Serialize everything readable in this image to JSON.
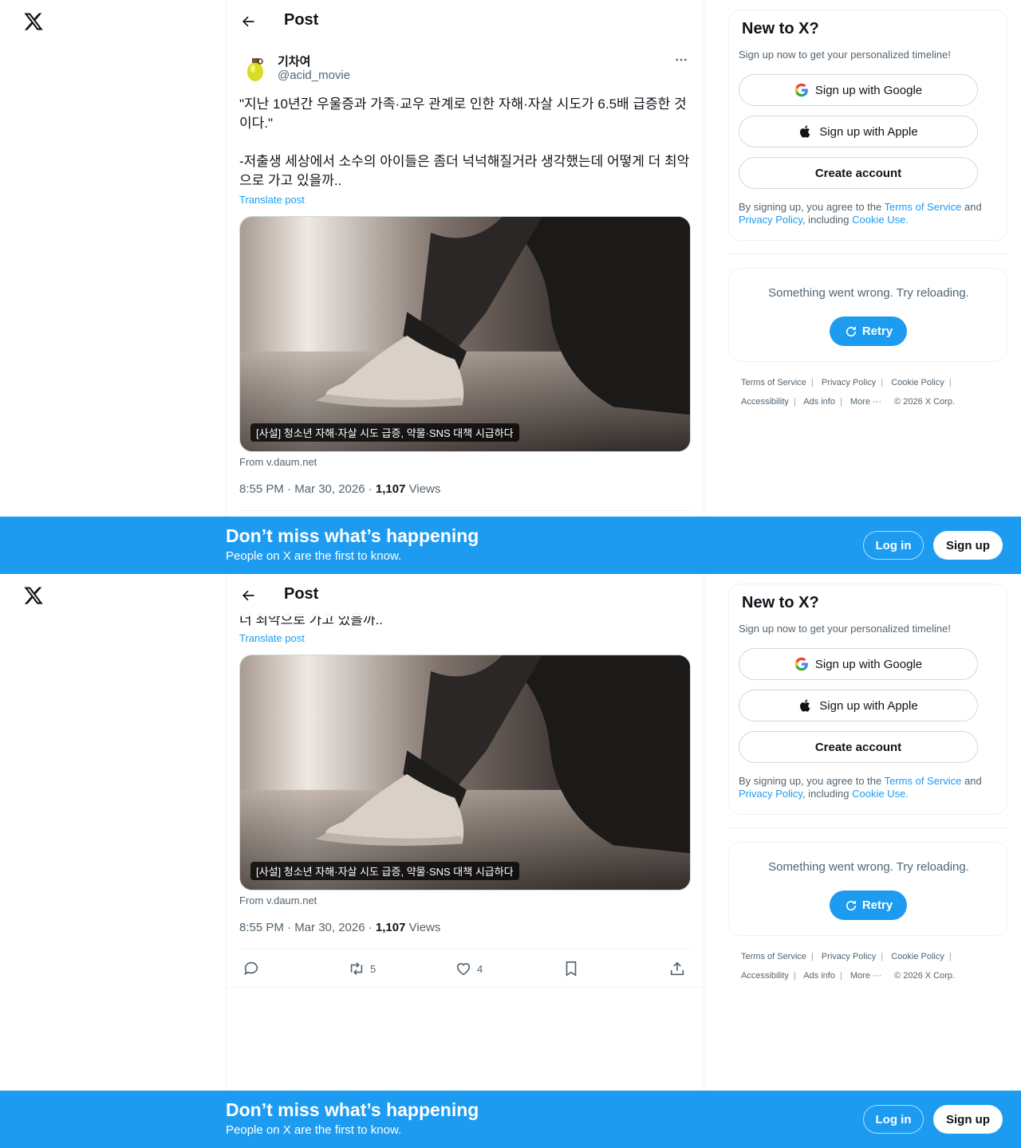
{
  "header": {
    "title": "Post"
  },
  "post": {
    "author_name": "기차여",
    "author_handle": "@acid_movie",
    "text": "\"지난 10년간 우울증과 가족·교우 관계로 인한 자해·자살 시도가 6.5배 급증한 것이다.\"\n\n-저출생 세상에서 소수의 아이들은 좀더 넉넉해질거라 생각했는데 어떻게 더 최악으로 가고 있을까..",
    "text_tail": "더 최악으로 가고 있을까..",
    "translate": "Translate post",
    "media_caption": "[사설] 청소년 자해·자살 시도 급증, 약물·SNS 대책 시급하다",
    "source": "From v.daum.net",
    "time": "8:55 PM · Mar 30, 2026 · ",
    "views_count": "1,107",
    "views_label": " Views",
    "stats": {
      "replies": "",
      "reposts": "5",
      "likes": "4"
    }
  },
  "sidebar": {
    "new_title": "New to X?",
    "new_sub": "Sign up now to get your personalized timeline!",
    "google": "Sign up with Google",
    "apple": "Sign up with Apple",
    "create": "Create account",
    "legal_pre": "By signing up, you agree to the ",
    "terms": "Terms of Service",
    "and": " and ",
    "privacy": "Privacy Policy",
    "including": ", including ",
    "cookie": "Cookie Use.",
    "error": "Something went wrong. Try reloading.",
    "retry": "Retry",
    "footer1": [
      "Terms of Service",
      "Privacy Policy",
      "Cookie Policy"
    ],
    "footer2": [
      "Accessibility",
      "Ads info",
      "More ···",
      "© 2026 X Corp."
    ]
  },
  "banner": {
    "title": "Don’t miss what’s happening",
    "sub": "People on X are the first to know.",
    "login": "Log in",
    "signup": "Sign up"
  },
  "colors": {
    "accent": "#1d9bf0",
    "text": "#0f1419",
    "muted": "#536471",
    "border": "#eff3f4"
  },
  "icons": [
    "x-logo-icon",
    "back-arrow-icon",
    "more-icon",
    "google-icon",
    "apple-icon",
    "retry-icon",
    "reply-icon",
    "repost-icon",
    "like-icon",
    "bookmark-icon",
    "share-icon"
  ]
}
